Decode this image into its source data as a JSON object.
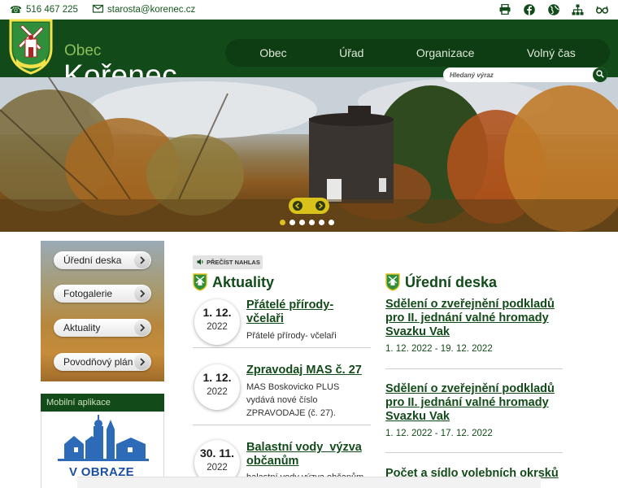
{
  "topbar": {
    "phone": "516 467 225",
    "email": "starosta@korenec.cz",
    "icons": [
      "printer-icon",
      "facebook-icon",
      "language-globe-icon",
      "sitemap-icon",
      "accessibility-glasses-icon"
    ]
  },
  "header": {
    "prefix": "Obec",
    "title": "Kořenec",
    "nav": [
      "Obec",
      "Úřad",
      "Organizace",
      "Volný čas"
    ],
    "search_placeholder": "Hledaný výraz"
  },
  "slider": {
    "slide_count": 6,
    "active_slide": 1
  },
  "sidebar": {
    "quick_links": [
      "Úřední deska",
      "Fotogalerie",
      "Aktuality",
      "Povodňový plán"
    ],
    "mobile_app_heading": "Mobilní aplikace",
    "mobile_app_banner": "V OBRAZE"
  },
  "news": {
    "read_aloud": "PŘEČÍST NAHLAS",
    "heading": "Aktuality",
    "items": [
      {
        "day": "1. 12.",
        "year": "2022",
        "title": "Přátelé přírody- včelaři",
        "desc": "Přátelé přírody- včelaři"
      },
      {
        "day": "1. 12.",
        "year": "2022",
        "title": "Zpravodaj MAS č. 27",
        "desc": "MAS Boskovicko PLUS vydává nové číslo ZPRAVODAJE (č. 27)."
      },
      {
        "day": "30. 11.",
        "year": "2022",
        "title": "Balastní vody_výzva občanům",
        "desc": "balastní vody výzva občanům"
      }
    ]
  },
  "board": {
    "heading": "Úřední deska",
    "items": [
      {
        "title": "Sdělení o zveřejnění podkladů pro II. jednání valné hromady Svazku Vak",
        "dates": "1. 12. 2022 - 19. 12. 2022"
      },
      {
        "title": "Sdělení o zveřejnění podkladů pro II. jednání valné hromady Svazku Vak",
        "dates": "1. 12. 2022 - 17. 12. 2022"
      },
      {
        "title": "Počet a sídlo volebních okrsků",
        "dates": ""
      }
    ]
  },
  "colors": {
    "brand_green": "#124b19",
    "nav_pill": "#0e3c13",
    "accent_yellow": "#e0c21f"
  }
}
